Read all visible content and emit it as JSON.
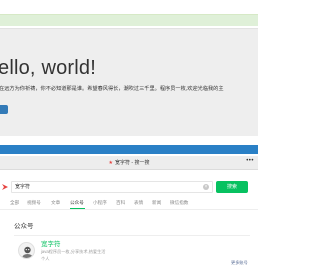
{
  "top_notice": {
    "text": ""
  },
  "hero": {
    "heading": "ello, world!",
    "paragraph": "在远方为你祈祷，你不必知道那是谁。希望春风得长，潮吹过三千里。程序员一枚,欢迎光临我的主",
    "button_label": ""
  },
  "blue_strip": {
    "text": ""
  },
  "wx": {
    "title": "宽字符 - 搜一搜",
    "title_icon": "star-icon",
    "more_label": "•••",
    "search": {
      "value": "宽字符",
      "clear_icon": "clear-icon",
      "button_label": "搜索"
    },
    "tabs": [
      {
        "label": "全部",
        "active": false
      },
      {
        "label": "视频号",
        "active": false
      },
      {
        "label": "文章",
        "active": false
      },
      {
        "label": "公众号",
        "active": true
      },
      {
        "label": "小程序",
        "active": false
      },
      {
        "label": "百科",
        "active": false
      },
      {
        "label": "表情",
        "active": false
      },
      {
        "label": "新闻",
        "active": false
      },
      {
        "label": "微信指数",
        "active": false
      }
    ],
    "section_title": "公众号",
    "account": {
      "name": "宽字符",
      "description": "java程序员一枚,分享技术,热爱生活",
      "type": "个人",
      "link": "更多账号"
    }
  },
  "colors": {
    "accent_green": "#07c160",
    "brand_red": "#e64340",
    "strip_blue": "#2a80c6",
    "link_blue": "#576b95",
    "notice_green": "#dff0d8"
  }
}
